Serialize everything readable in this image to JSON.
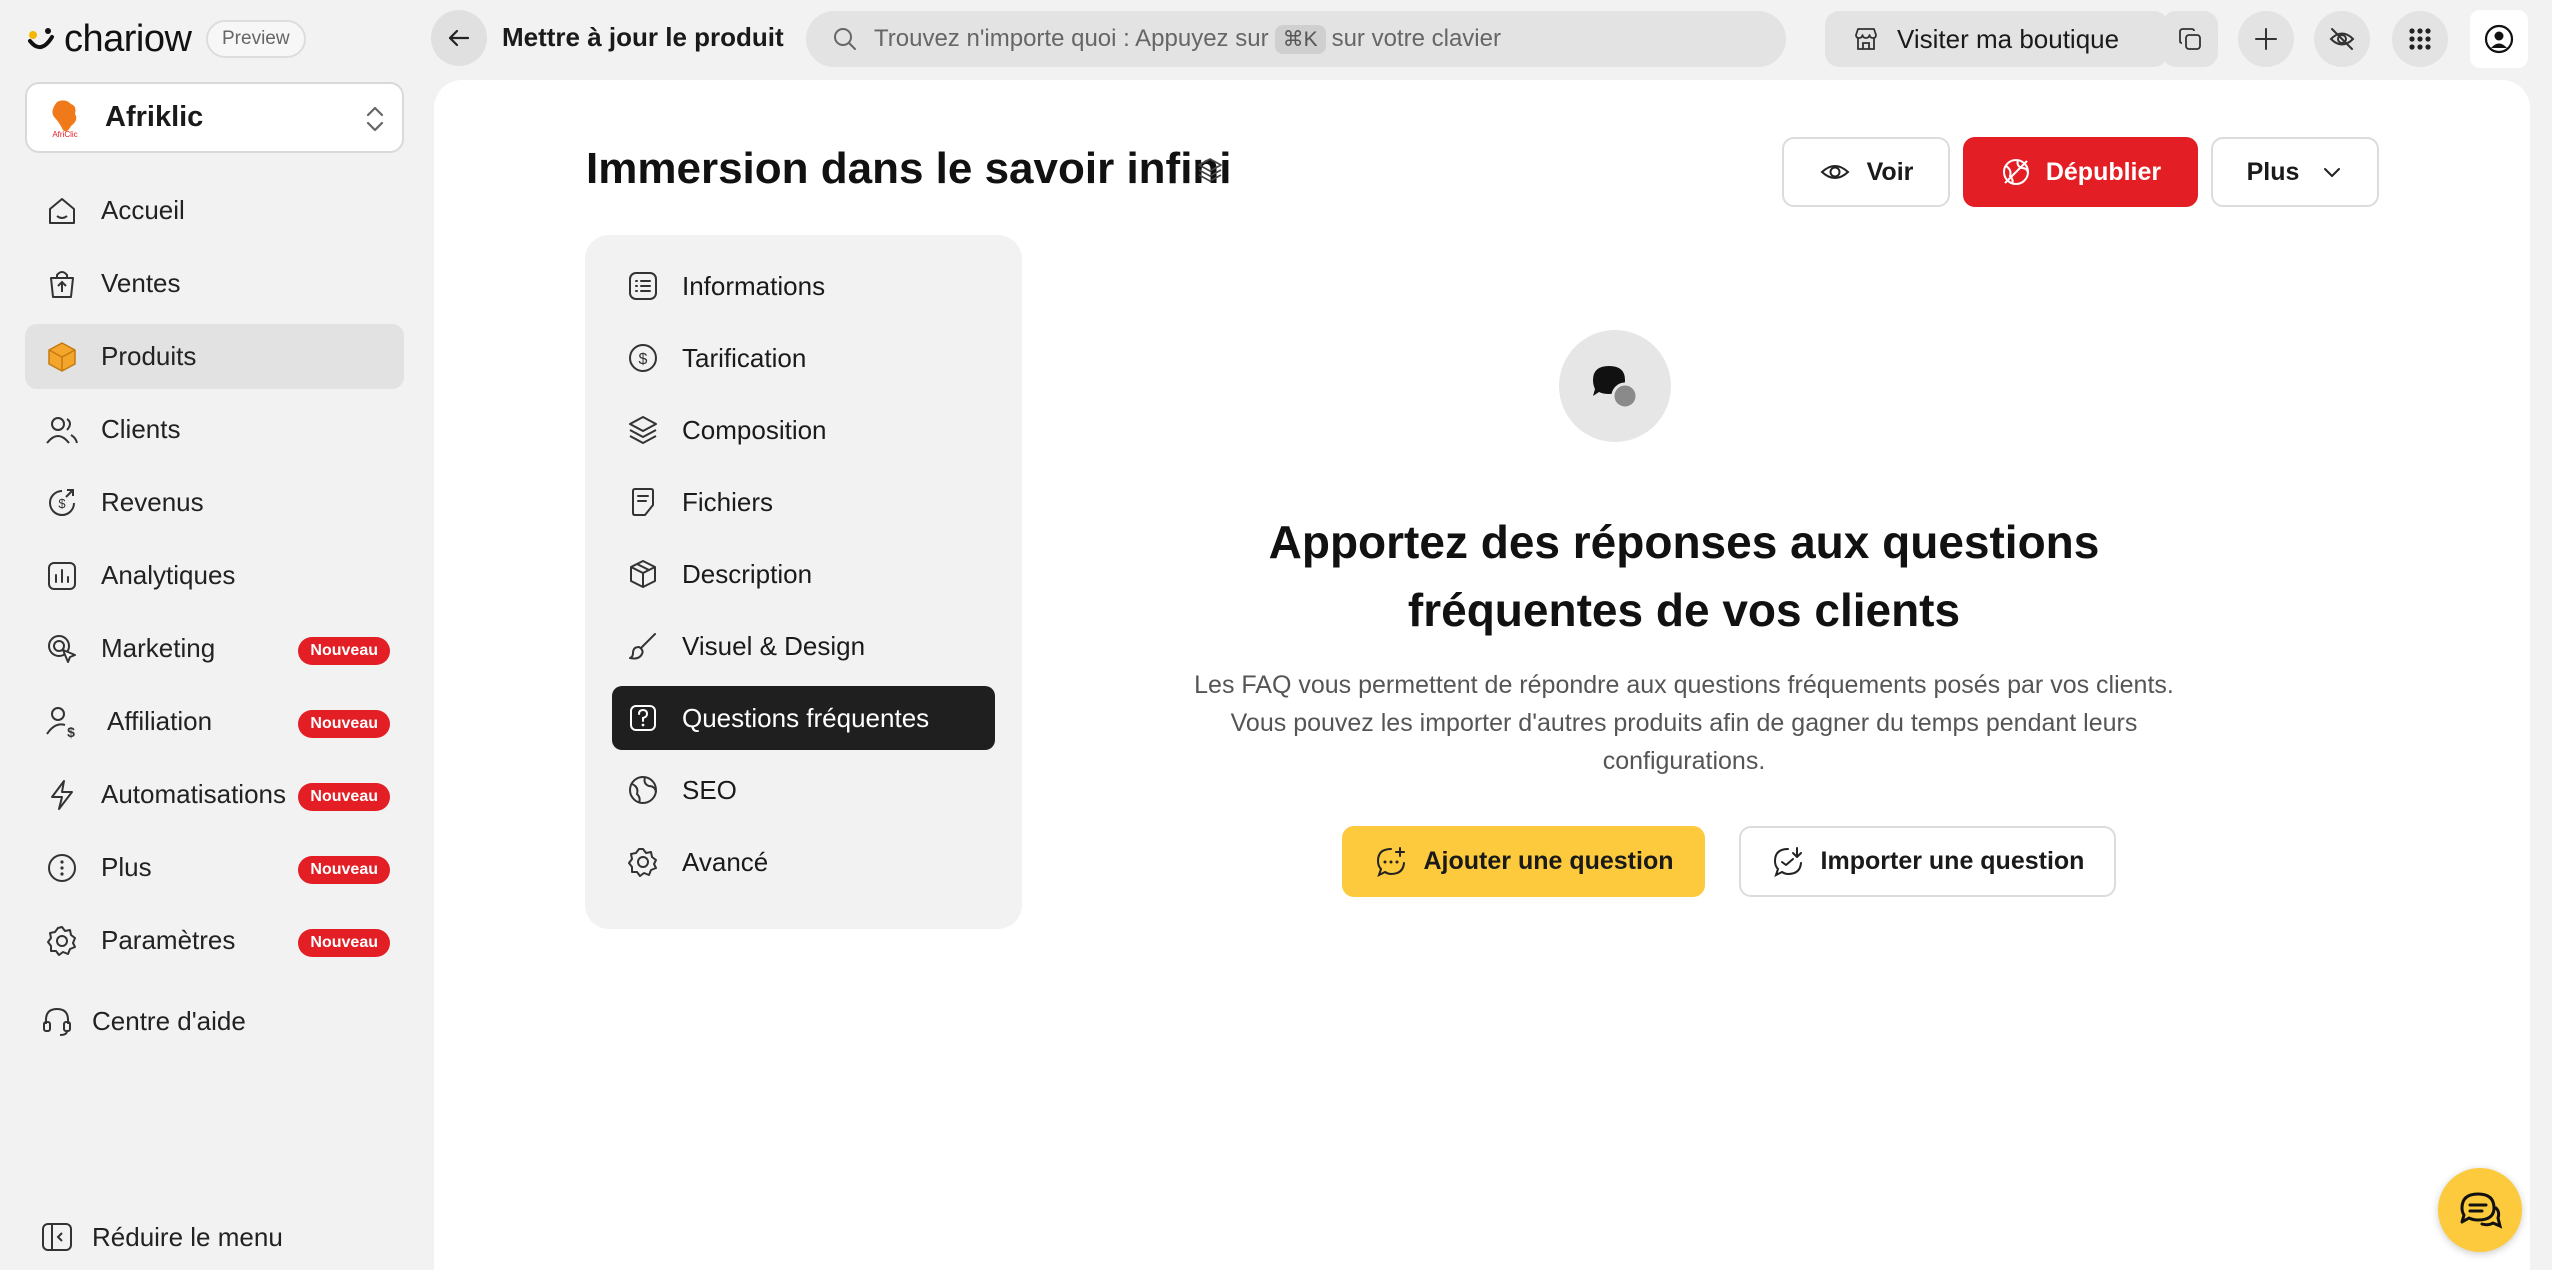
{
  "brand": {
    "name": "chariow",
    "badge": "Preview"
  },
  "store": {
    "name": "Afriklic",
    "logo_text": "AfriClic"
  },
  "nav": [
    {
      "label": "Accueil",
      "icon": "home-icon",
      "active": false,
      "badge": ""
    },
    {
      "label": "Ventes",
      "icon": "shopping-bag-icon",
      "active": false,
      "badge": ""
    },
    {
      "label": "Produits",
      "icon": "box-icon",
      "active": true,
      "badge": ""
    },
    {
      "label": "Clients",
      "icon": "users-icon",
      "active": false,
      "badge": ""
    },
    {
      "label": "Revenus",
      "icon": "revenue-icon",
      "active": false,
      "badge": ""
    },
    {
      "label": "Analytiques",
      "icon": "analytics-icon",
      "active": false,
      "badge": ""
    },
    {
      "label": "Marketing",
      "icon": "marketing-icon",
      "active": false,
      "badge": "Nouveau"
    },
    {
      "label": "Affiliation",
      "icon": "affiliation-icon",
      "active": false,
      "badge": "Nouveau"
    },
    {
      "label": "Automatisations",
      "icon": "lightning-icon",
      "active": false,
      "badge": "Nouveau"
    },
    {
      "label": "Plus",
      "icon": "more-icon",
      "active": false,
      "badge": "Nouveau"
    },
    {
      "label": "Paramètres",
      "icon": "gear-icon",
      "active": false,
      "badge": "Nouveau"
    }
  ],
  "help_label": "Centre d'aide",
  "reduce_label": "Réduire le menu",
  "topbar": {
    "heading": "Mettre à jour le produit",
    "search_before": "Trouvez n'importe quoi : Appuyez sur",
    "search_key": "⌘K",
    "search_after": "sur votre clavier",
    "visit_label": "Visiter ma boutique"
  },
  "product": {
    "title": "Immersion dans le savoir infini",
    "btn_view": "Voir",
    "btn_unpublish": "Dépublier",
    "btn_more": "Plus"
  },
  "tabs": [
    {
      "label": "Informations",
      "icon": "list-icon",
      "active": false
    },
    {
      "label": "Tarification",
      "icon": "dollar-icon",
      "active": false
    },
    {
      "label": "Composition",
      "icon": "layers-icon",
      "active": false
    },
    {
      "label": "Fichiers",
      "icon": "file-icon",
      "active": false
    },
    {
      "label": "Description",
      "icon": "cube-icon",
      "active": false
    },
    {
      "label": "Visuel & Design",
      "icon": "brush-icon",
      "active": false
    },
    {
      "label": "Questions fréquentes",
      "icon": "question-icon",
      "active": true
    },
    {
      "label": "SEO",
      "icon": "globe-icon",
      "active": false
    },
    {
      "label": "Avancé",
      "icon": "gear-icon",
      "active": false
    }
  ],
  "faq": {
    "title_line1": "Apportez des réponses aux questions",
    "title_line2": "fréquentes de vos clients",
    "desc": "Les FAQ vous permettent de répondre aux questions fréquements posés par vos clients. Vous pouvez les importer d'autres produits afin de gagner du temps pendant leurs configurations.",
    "btn_add": "Ajouter une question",
    "btn_import": "Importer une question"
  },
  "colors": {
    "accent_red": "#e31e25",
    "accent_yellow": "#fcca3c",
    "active_tab": "#1f1f1f"
  }
}
